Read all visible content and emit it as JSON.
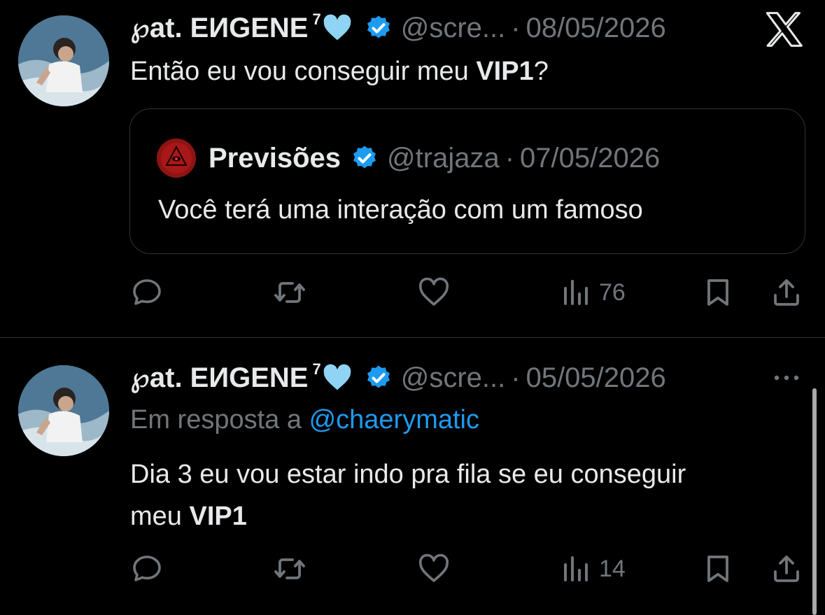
{
  "tweets": [
    {
      "author_name": "℘at. EИGENE",
      "author_superscript": "7",
      "handle": "@scre...",
      "date": "08/05/2026",
      "text_normal": "Então eu vou conseguir meu ",
      "text_bold": "VIP1",
      "text_after": "?",
      "quote": {
        "author_name": "Previsões",
        "handle": "@trajaza",
        "date": "07/05/2026",
        "text": "Você terá uma interação com um famoso"
      },
      "views": "76"
    },
    {
      "author_name": "℘at. EИGENE",
      "author_superscript": "7",
      "handle": "@scre...",
      "date": "05/05/2026",
      "reply_prefix": "Em resposta a ",
      "reply_to": "@chaerymatic",
      "text_line1": "Dia 3 eu vou estar indo pra fila se eu conseguir",
      "text_line2_normal": "meu ",
      "text_line2_bold": "VIP1",
      "views": "14"
    }
  ],
  "separator": "·",
  "icons": {
    "app_logo": "x-logo-icon",
    "verified": "verified-badge-icon",
    "heart_emoji": "light-blue-heart-icon",
    "reply": "reply-icon",
    "retweet": "retweet-icon",
    "like": "heart-icon",
    "views": "views-icon",
    "bookmark": "bookmark-icon",
    "share": "share-icon",
    "more": "more-icon"
  },
  "colors": {
    "background": "#000000",
    "text": "#e7e9ea",
    "muted": "#71767b",
    "accent": "#1d9bf0",
    "verified": "#1d9bf0",
    "border": "#2f3336"
  }
}
